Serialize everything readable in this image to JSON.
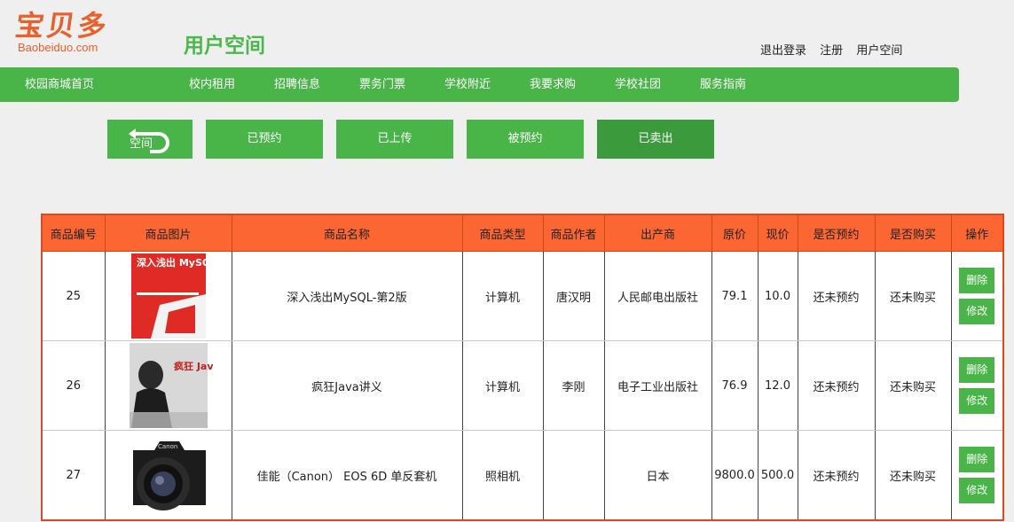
{
  "logo": {
    "cn": "宝贝多",
    "en": "Baobeiduo.com"
  },
  "page_title": "用户空间",
  "top_links": {
    "logout": "退出登录",
    "register": "注册",
    "user_space": "用户空间"
  },
  "nav": {
    "home": "校园商城首页",
    "items": [
      "校内租用",
      "招聘信息",
      "票务门票",
      "学校附近",
      "我要求购",
      "学校社团",
      "服务指南"
    ]
  },
  "tabs": {
    "back": "空间",
    "items": [
      "已预约",
      "已上传",
      "被预约",
      "已卖出"
    ],
    "active_index": 3
  },
  "table": {
    "headers": [
      "商品编号",
      "商品图片",
      "商品名称",
      "商品类型",
      "商品作者",
      "出产商",
      "原价",
      "现价",
      "是否预约",
      "是否购买",
      "操作"
    ],
    "rows": [
      {
        "id": "25",
        "image": "mysql-book-cover",
        "name": "深入浅出MySQL-第2版",
        "type": "计算机",
        "author": "唐汉明",
        "maker": "人民邮电出版社",
        "orig_price": "79.1",
        "price": "10.0",
        "reserved": "还未预约",
        "bought": "还未购买",
        "img_text": "深入浅出 MySQL"
      },
      {
        "id": "26",
        "image": "java-book-cover",
        "name": "疯狂Java讲义",
        "type": "计算机",
        "author": "李刚",
        "maker": "电子工业出版社",
        "orig_price": "76.9",
        "price": "12.0",
        "reserved": "还未预约",
        "bought": "还未购买",
        "img_text": "疯狂 Java讲义"
      },
      {
        "id": "27",
        "image": "canon-camera",
        "name": "佳能（Canon） EOS 6D 单反套机",
        "type": "照相机",
        "author": "",
        "maker": "日本",
        "orig_price": "9800.0",
        "price": "500.0",
        "reserved": "还未预约",
        "bought": "还未购买",
        "img_text": "Canon"
      }
    ],
    "actions": {
      "delete": "删除",
      "edit": "修改"
    }
  },
  "colors": {
    "green": "#49b548",
    "green_active": "#3b9a3c",
    "header_orange": "#fb6632",
    "logo_orange": "#e8602c",
    "title_green": "#4cb84a"
  }
}
